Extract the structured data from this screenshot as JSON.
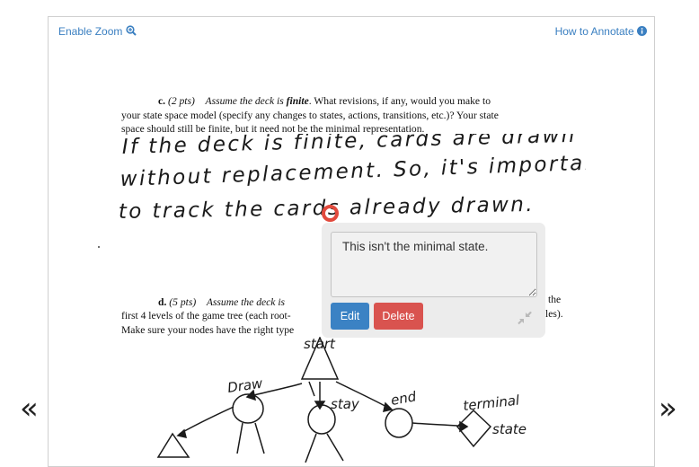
{
  "toolbar": {
    "enable_zoom_label": "Enable Zoom",
    "how_to_annotate_label": "How to Annotate",
    "zoom_icon": "zoom-in-icon",
    "info_icon": "info-icon"
  },
  "document": {
    "part_c": {
      "label": "c.",
      "points": "(2 pts)",
      "assume": "Assume the deck is",
      "emph": "finite",
      "line1_rest": ". What revisions, if any, would you make to",
      "line2": "your state space model (specify any changes to states, actions, transitions, etc.)? Your state",
      "line3": "space should still be finite, but it need not be the minimal representation."
    },
    "handwriting": {
      "line1": "If the deck is finite, cards are drawn",
      "line2": "without replacement. So, it's important",
      "line3": "to track the cards already drawn."
    },
    "part_d": {
      "label": "d.",
      "points": "(5 pts)",
      "assume": "Assume the deck is",
      "line1_tail": "the",
      "line2": "first 4 levels of the game tree (each root-",
      "line2_tail": "les).",
      "line3": "Make sure your nodes have the right type"
    },
    "tree_labels": {
      "start": "start",
      "draw": "Draw",
      "stay": "stay",
      "end": "end",
      "terminal": "terminal",
      "state": "state"
    }
  },
  "annotation": {
    "comment_text": "This isn't the minimal state.",
    "edit_label": "Edit",
    "delete_label": "Delete",
    "marker_color": "#e24a3d"
  },
  "nav": {
    "prev_glyph": "«",
    "next_glyph": "»"
  },
  "colors": {
    "link": "#3a7fc1",
    "edit_button": "#3b82c4",
    "delete_button": "#d9534f"
  }
}
